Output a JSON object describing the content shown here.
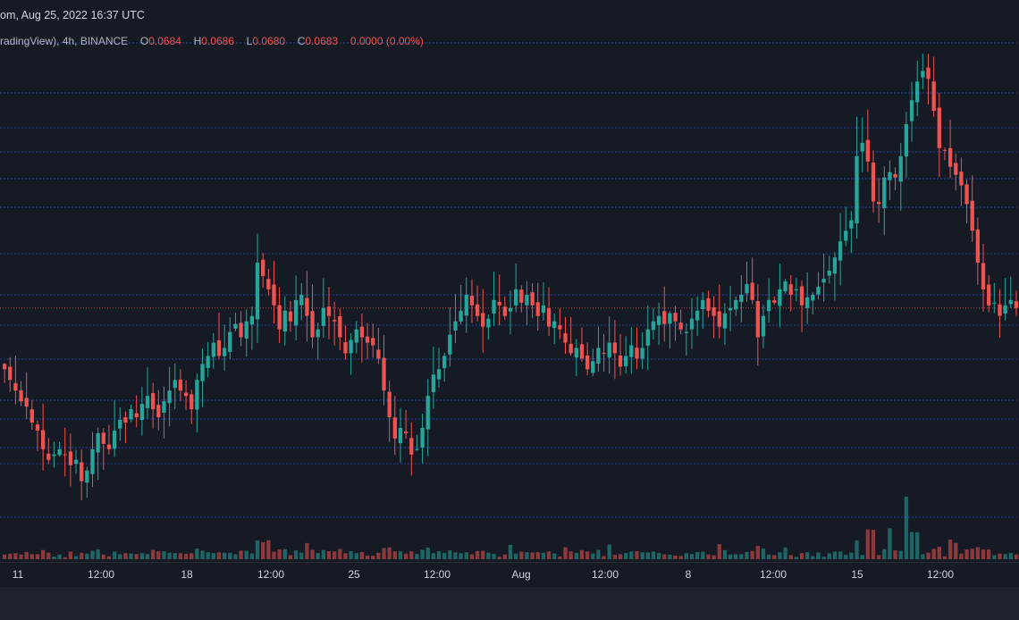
{
  "header": {
    "source_line": "om, Aug 25, 2022 16:37 UTC"
  },
  "legend": {
    "symbol_suffix": "radingView), 4h, BINANCE",
    "o_label": "O",
    "o_value": "0.0684",
    "h_label": "H",
    "h_value": "0.0686",
    "l_label": "L",
    "l_value": "0.0680",
    "c_label": "C",
    "c_value": "0.0683",
    "change": "0.0000 (0.00%)"
  },
  "colors": {
    "up": "#26a69a",
    "down": "#ef5350",
    "background": "#161a25",
    "grid": "#2962ff",
    "text": "#d1d4dc"
  },
  "chart_data": {
    "type": "candlestick",
    "interval": "4h",
    "exchange": "BINANCE",
    "x_tick_labels": [
      "11",
      "12:00",
      "18",
      "12:00",
      "25",
      "12:00",
      "Aug",
      "12:00",
      "8",
      "12:00",
      "15",
      "12:00"
    ],
    "price_gridlines": "dotted horizontal lines",
    "series": [
      {
        "name": "price",
        "close": [
          0.066,
          0.0656,
          0.0652,
          0.0648,
          0.0646,
          0.064,
          0.0637,
          0.063,
          0.0626,
          0.0628,
          0.063,
          0.0628,
          0.0624,
          0.0626,
          0.0618,
          0.0622,
          0.063,
          0.0636,
          0.0632,
          0.063,
          0.0637,
          0.0641,
          0.064,
          0.0645,
          0.0642,
          0.0647,
          0.065,
          0.0645,
          0.0642,
          0.0648,
          0.0652,
          0.0656,
          0.0652,
          0.065,
          0.0645,
          0.0656,
          0.0662,
          0.0665,
          0.067,
          0.0665,
          0.0668,
          0.0674,
          0.0677,
          0.0672,
          0.0678,
          0.068,
          0.07,
          0.0695,
          0.069,
          0.0684,
          0.0675,
          0.0682,
          0.0678,
          0.0686,
          0.0688,
          0.068,
          0.0672,
          0.0675,
          0.0683,
          0.068,
          0.0678,
          0.0672,
          0.0666,
          0.0671,
          0.0675,
          0.0672,
          0.067,
          0.0669,
          0.0664,
          0.0652,
          0.0642,
          0.0634,
          0.0638,
          0.0636,
          0.0628,
          0.063,
          0.0638,
          0.065,
          0.0658,
          0.066,
          0.0665,
          0.0673,
          0.0678,
          0.0682,
          0.0688,
          0.0684,
          0.068,
          0.0676,
          0.0679,
          0.0686,
          0.0684,
          0.068,
          0.0683,
          0.069,
          0.0685,
          0.0688,
          0.0684,
          0.068,
          0.0684,
          0.0676,
          0.0678,
          0.0675,
          0.067,
          0.0666,
          0.0668,
          0.0664,
          0.066,
          0.0663,
          0.0668,
          0.0666,
          0.067,
          0.0666,
          0.0661,
          0.0665,
          0.0669,
          0.0664,
          0.0668,
          0.0675,
          0.0678,
          0.068,
          0.0677,
          0.0681,
          0.0678,
          0.0675,
          0.0674,
          0.0679,
          0.0682,
          0.0686,
          0.0682,
          0.068,
          0.0676,
          0.0681,
          0.0683,
          0.0686,
          0.0688,
          0.0692,
          0.0686,
          0.0672,
          0.068,
          0.0686,
          0.0685,
          0.069,
          0.0693,
          0.0688,
          0.069,
          0.0684,
          0.0687,
          0.0688,
          0.0691,
          0.0694,
          0.0697,
          0.0702,
          0.0708,
          0.0712,
          0.0716,
          0.074,
          0.0745,
          0.0738,
          0.0723,
          0.0722,
          0.0732,
          0.0734,
          0.0732,
          0.074,
          0.0752,
          0.0761,
          0.0768,
          0.0772,
          0.0769,
          0.0757,
          0.0743,
          0.0742,
          0.0736,
          0.0733,
          0.0729,
          0.0722,
          0.0712,
          0.07,
          0.069,
          0.0684,
          0.0685,
          0.068,
          0.0684,
          0.0686,
          0.0683
        ]
      }
    ]
  }
}
